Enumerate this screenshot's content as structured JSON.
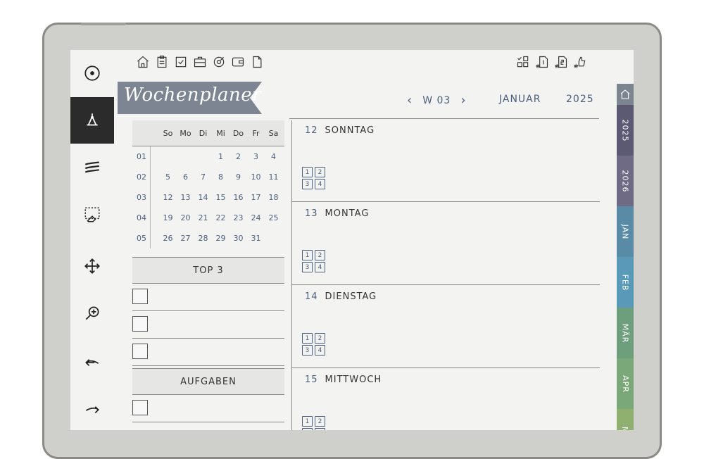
{
  "toolbar": {
    "tools": [
      {
        "name": "pen-tool",
        "icon": "circle-dot-icon"
      },
      {
        "name": "shape-tool",
        "icon": "pen-nib-icon",
        "active": true
      },
      {
        "name": "brush-tool",
        "icon": "wave-lines-icon"
      },
      {
        "name": "eraser-tool",
        "icon": "eraser-select-icon"
      },
      {
        "name": "move-tool",
        "icon": "move-arrows-icon"
      },
      {
        "name": "zoom-tool",
        "icon": "zoom-in-icon"
      },
      {
        "name": "undo-tool",
        "icon": "undo-icon"
      },
      {
        "name": "redo-tool",
        "icon": "redo-icon"
      }
    ]
  },
  "header": {
    "title": "Wochenplaner",
    "week_label": "W 03",
    "month": "JANUAR",
    "year": "2025"
  },
  "calendar": {
    "weekdays": [
      "So",
      "Mo",
      "Di",
      "Mi",
      "Do",
      "Fr",
      "Sa"
    ],
    "weeks": [
      {
        "wk": "01",
        "days": [
          "",
          "",
          "",
          "1",
          "2",
          "3",
          "4"
        ]
      },
      {
        "wk": "02",
        "days": [
          "5",
          "6",
          "7",
          "8",
          "9",
          "10",
          "11"
        ]
      },
      {
        "wk": "03",
        "days": [
          "12",
          "13",
          "14",
          "15",
          "16",
          "17",
          "18"
        ]
      },
      {
        "wk": "04",
        "days": [
          "19",
          "20",
          "21",
          "22",
          "23",
          "24",
          "25"
        ]
      },
      {
        "wk": "05",
        "days": [
          "26",
          "27",
          "28",
          "29",
          "30",
          "31",
          ""
        ]
      }
    ]
  },
  "sections": {
    "top3": "TOP 3",
    "tasks": "AUFGABEN"
  },
  "days": [
    {
      "num": "12",
      "name": "SONNTAG"
    },
    {
      "num": "13",
      "name": "MONTAG"
    },
    {
      "num": "14",
      "name": "DIENSTAG"
    },
    {
      "num": "15",
      "name": "MITTWOCH"
    }
  ],
  "page_icons": [
    "1",
    "2",
    "3",
    "4"
  ],
  "tabs": [
    {
      "label": "2025",
      "color": "#5c5a73"
    },
    {
      "label": "2026",
      "color": "#6f6b85"
    },
    {
      "label": "JAN",
      "color": "#5a8ba6"
    },
    {
      "label": "FEB",
      "color": "#5b99b8"
    },
    {
      "label": "MÄR",
      "color": "#6e9f7c"
    },
    {
      "label": "APR",
      "color": "#7aa878"
    },
    {
      "label": "MAI",
      "color": "#8fb070"
    }
  ],
  "colors": {
    "accent": "#4a5f7f",
    "banner": "#7d8593",
    "active_tool": "#2b2b2b"
  }
}
